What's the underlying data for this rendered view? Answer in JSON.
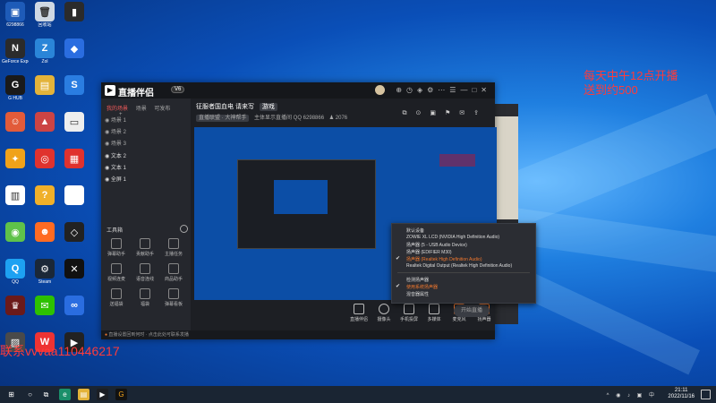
{
  "desktop": {
    "icons": [
      {
        "label": "6298866",
        "color": "#1e5bb8",
        "glyph": "▣"
      },
      {
        "label": "回收站",
        "color": "#cfd8e3",
        "glyph": "🗑"
      },
      {
        "label": "",
        "color": "#2b2b2b",
        "glyph": "▮"
      },
      {
        "label": "GeForce Experience",
        "color": "#2b2b2b",
        "glyph": "N"
      },
      {
        "label": "Zol",
        "color": "#2a85d8",
        "glyph": "Z"
      },
      {
        "label": "",
        "color": "#2a6de0",
        "glyph": "◆"
      },
      {
        "label": "G HUB",
        "color": "#1a1a1a",
        "glyph": "G"
      },
      {
        "label": "",
        "color": "#e3b33a",
        "glyph": "▤"
      },
      {
        "label": "",
        "color": "#2a7de1",
        "glyph": "S"
      },
      {
        "label": "",
        "color": "#e25b3a",
        "glyph": "☺"
      },
      {
        "label": "",
        "color": "#c44",
        "glyph": "▲"
      },
      {
        "label": "",
        "color": "#eee",
        "glyph": "▭"
      },
      {
        "label": "",
        "color": "#f0a21a",
        "glyph": "✦"
      },
      {
        "label": "",
        "color": "#e0322e",
        "glyph": "◎"
      },
      {
        "label": "",
        "color": "#e0322e",
        "glyph": "▦"
      },
      {
        "label": "",
        "color": "#fff",
        "glyph": "▥"
      },
      {
        "label": "",
        "color": "#f0b02a",
        "glyph": "?"
      },
      {
        "label": "",
        "color": "#fff",
        "glyph": ""
      },
      {
        "label": "",
        "color": "#5fc24a",
        "glyph": "◉"
      },
      {
        "label": "",
        "color": "#ff6b22",
        "glyph": "☻"
      },
      {
        "label": "",
        "color": "#222",
        "glyph": "◇"
      },
      {
        "label": "QQ",
        "color": "#1da1f2",
        "glyph": "Q"
      },
      {
        "label": "Steam",
        "color": "#1b2838",
        "glyph": "⚙"
      },
      {
        "label": "",
        "color": "#111",
        "glyph": "✕"
      },
      {
        "label": "",
        "color": "#6b1a1a",
        "glyph": "♛"
      },
      {
        "label": "",
        "color": "#2dc100",
        "glyph": "✉"
      },
      {
        "label": "",
        "color": "#2a6de0",
        "glyph": "∞"
      },
      {
        "label": "",
        "color": "#4a4a4a",
        "glyph": "▨"
      },
      {
        "label": "",
        "color": "#e33",
        "glyph": "W"
      },
      {
        "label": "",
        "color": "#222",
        "glyph": "▶"
      }
    ]
  },
  "overlay": {
    "line1": "每天中午12点开播",
    "line2": "送到约500",
    "contact": "联系vvvaa110446217"
  },
  "app": {
    "name": "直播伴侣",
    "version": "V6",
    "side_tabs": [
      "我的场景",
      "场景",
      "可发布"
    ],
    "scenes": [
      "场景 1",
      "场景 2",
      "场景 3",
      "文本 2",
      "文本 1",
      "全屏 1"
    ],
    "tools_title": "工具箱",
    "tools": [
      [
        "弹幕助手",
        "贡献助手",
        "主播任务"
      ],
      [
        "视频连麦",
        "语音连线",
        "商品助手"
      ],
      [
        "送福袋",
        "福袋",
        "弹幕看板"
      ]
    ],
    "stream_title": "征服者国血电 请来写",
    "stream_tag": "游戏",
    "stream_sub_badge": "直播联盟 · 大神帮手",
    "stream_sub": "主体显示直播间 QQ 6298866",
    "stream_count": "2076",
    "bottom_buttons": [
      "直播伴侣",
      "摄像头",
      "手机投屏",
      "多媒体",
      "麦克风",
      "扬声器"
    ],
    "go_live": "开始直播",
    "status_text": "直播设置回到何时 · 点击此处可联系发播"
  },
  "audio_menu": {
    "items": [
      {
        "label": "默认设备",
        "selected": false,
        "checked": false
      },
      {
        "label": "ZOWIE XL LCD (NVIDIA High Definition Audio)",
        "selected": false,
        "checked": false
      },
      {
        "label": "扬声器 (5 - USB Audio Device)",
        "selected": false,
        "checked": false
      },
      {
        "label": "扬声器 (EDIFIER M30)",
        "selected": false,
        "checked": false
      },
      {
        "label": "扬声器 (Realtek High Definition Audio)",
        "selected": true,
        "checked": true
      },
      {
        "label": "Realtek Digital Output (Realtek High Definition Audio)",
        "selected": false,
        "checked": false
      },
      {
        "label": "检测扬声器",
        "selected": false,
        "checked": false
      },
      {
        "label": "使用系统扬声器",
        "selected": true,
        "checked": true
      },
      {
        "label": "混音器属性",
        "selected": false,
        "checked": false
      }
    ]
  },
  "taskbar": {
    "time": "21:11",
    "date": "2022/11/16"
  }
}
